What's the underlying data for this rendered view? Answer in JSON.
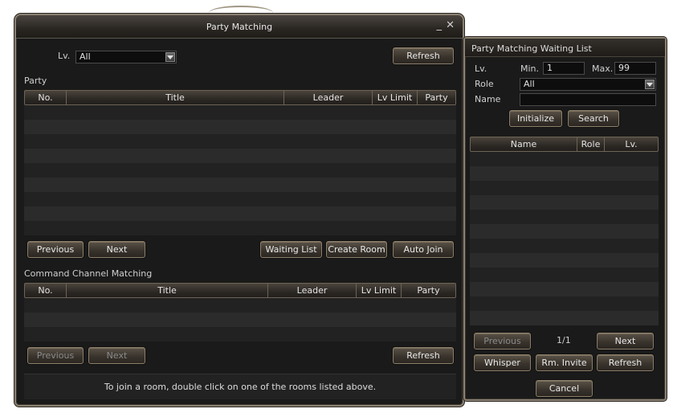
{
  "main": {
    "title": "Party Matching",
    "minimize_glyph": "_",
    "close_glyph": "✕",
    "lv_label": "Lv.",
    "lv_select": "All",
    "refresh_top": "Refresh",
    "party_section": "Party",
    "party_columns": [
      "No.",
      "Title",
      "Leader",
      "Lv Limit",
      "Party"
    ],
    "party_prev": "Previous",
    "party_next": "Next",
    "waiting_list": "Waiting List",
    "create_room": "Create Room",
    "auto_join": "Auto Join",
    "cc_section": "Command Channel Matching",
    "cc_columns": [
      "No.",
      "Title",
      "Leader",
      "Lv Limit",
      "Party"
    ],
    "cc_prev": "Previous",
    "cc_next": "Next",
    "cc_refresh": "Refresh",
    "hint": "To join a room, double click on one of the rooms listed above."
  },
  "side": {
    "title": "Party Matching Waiting List",
    "lv_label": "Lv.",
    "min_label": "Min.",
    "min_value": "1",
    "max_label": "Max.",
    "max_value": "99",
    "role_label": "Role",
    "role_select": "All",
    "name_label": "Name",
    "name_value": "",
    "initialize": "Initialize",
    "search": "Search",
    "columns": [
      "Name",
      "Role",
      "Lv."
    ],
    "prev": "Previous",
    "page": "1/1",
    "next": "Next",
    "whisper": "Whisper",
    "rm_invite": "Rm. Invite",
    "refresh": "Refresh",
    "cancel": "Cancel"
  },
  "colors": {
    "window_bg": "#1a1a1a",
    "frame": "#8a8172",
    "button": "#3a342d"
  }
}
